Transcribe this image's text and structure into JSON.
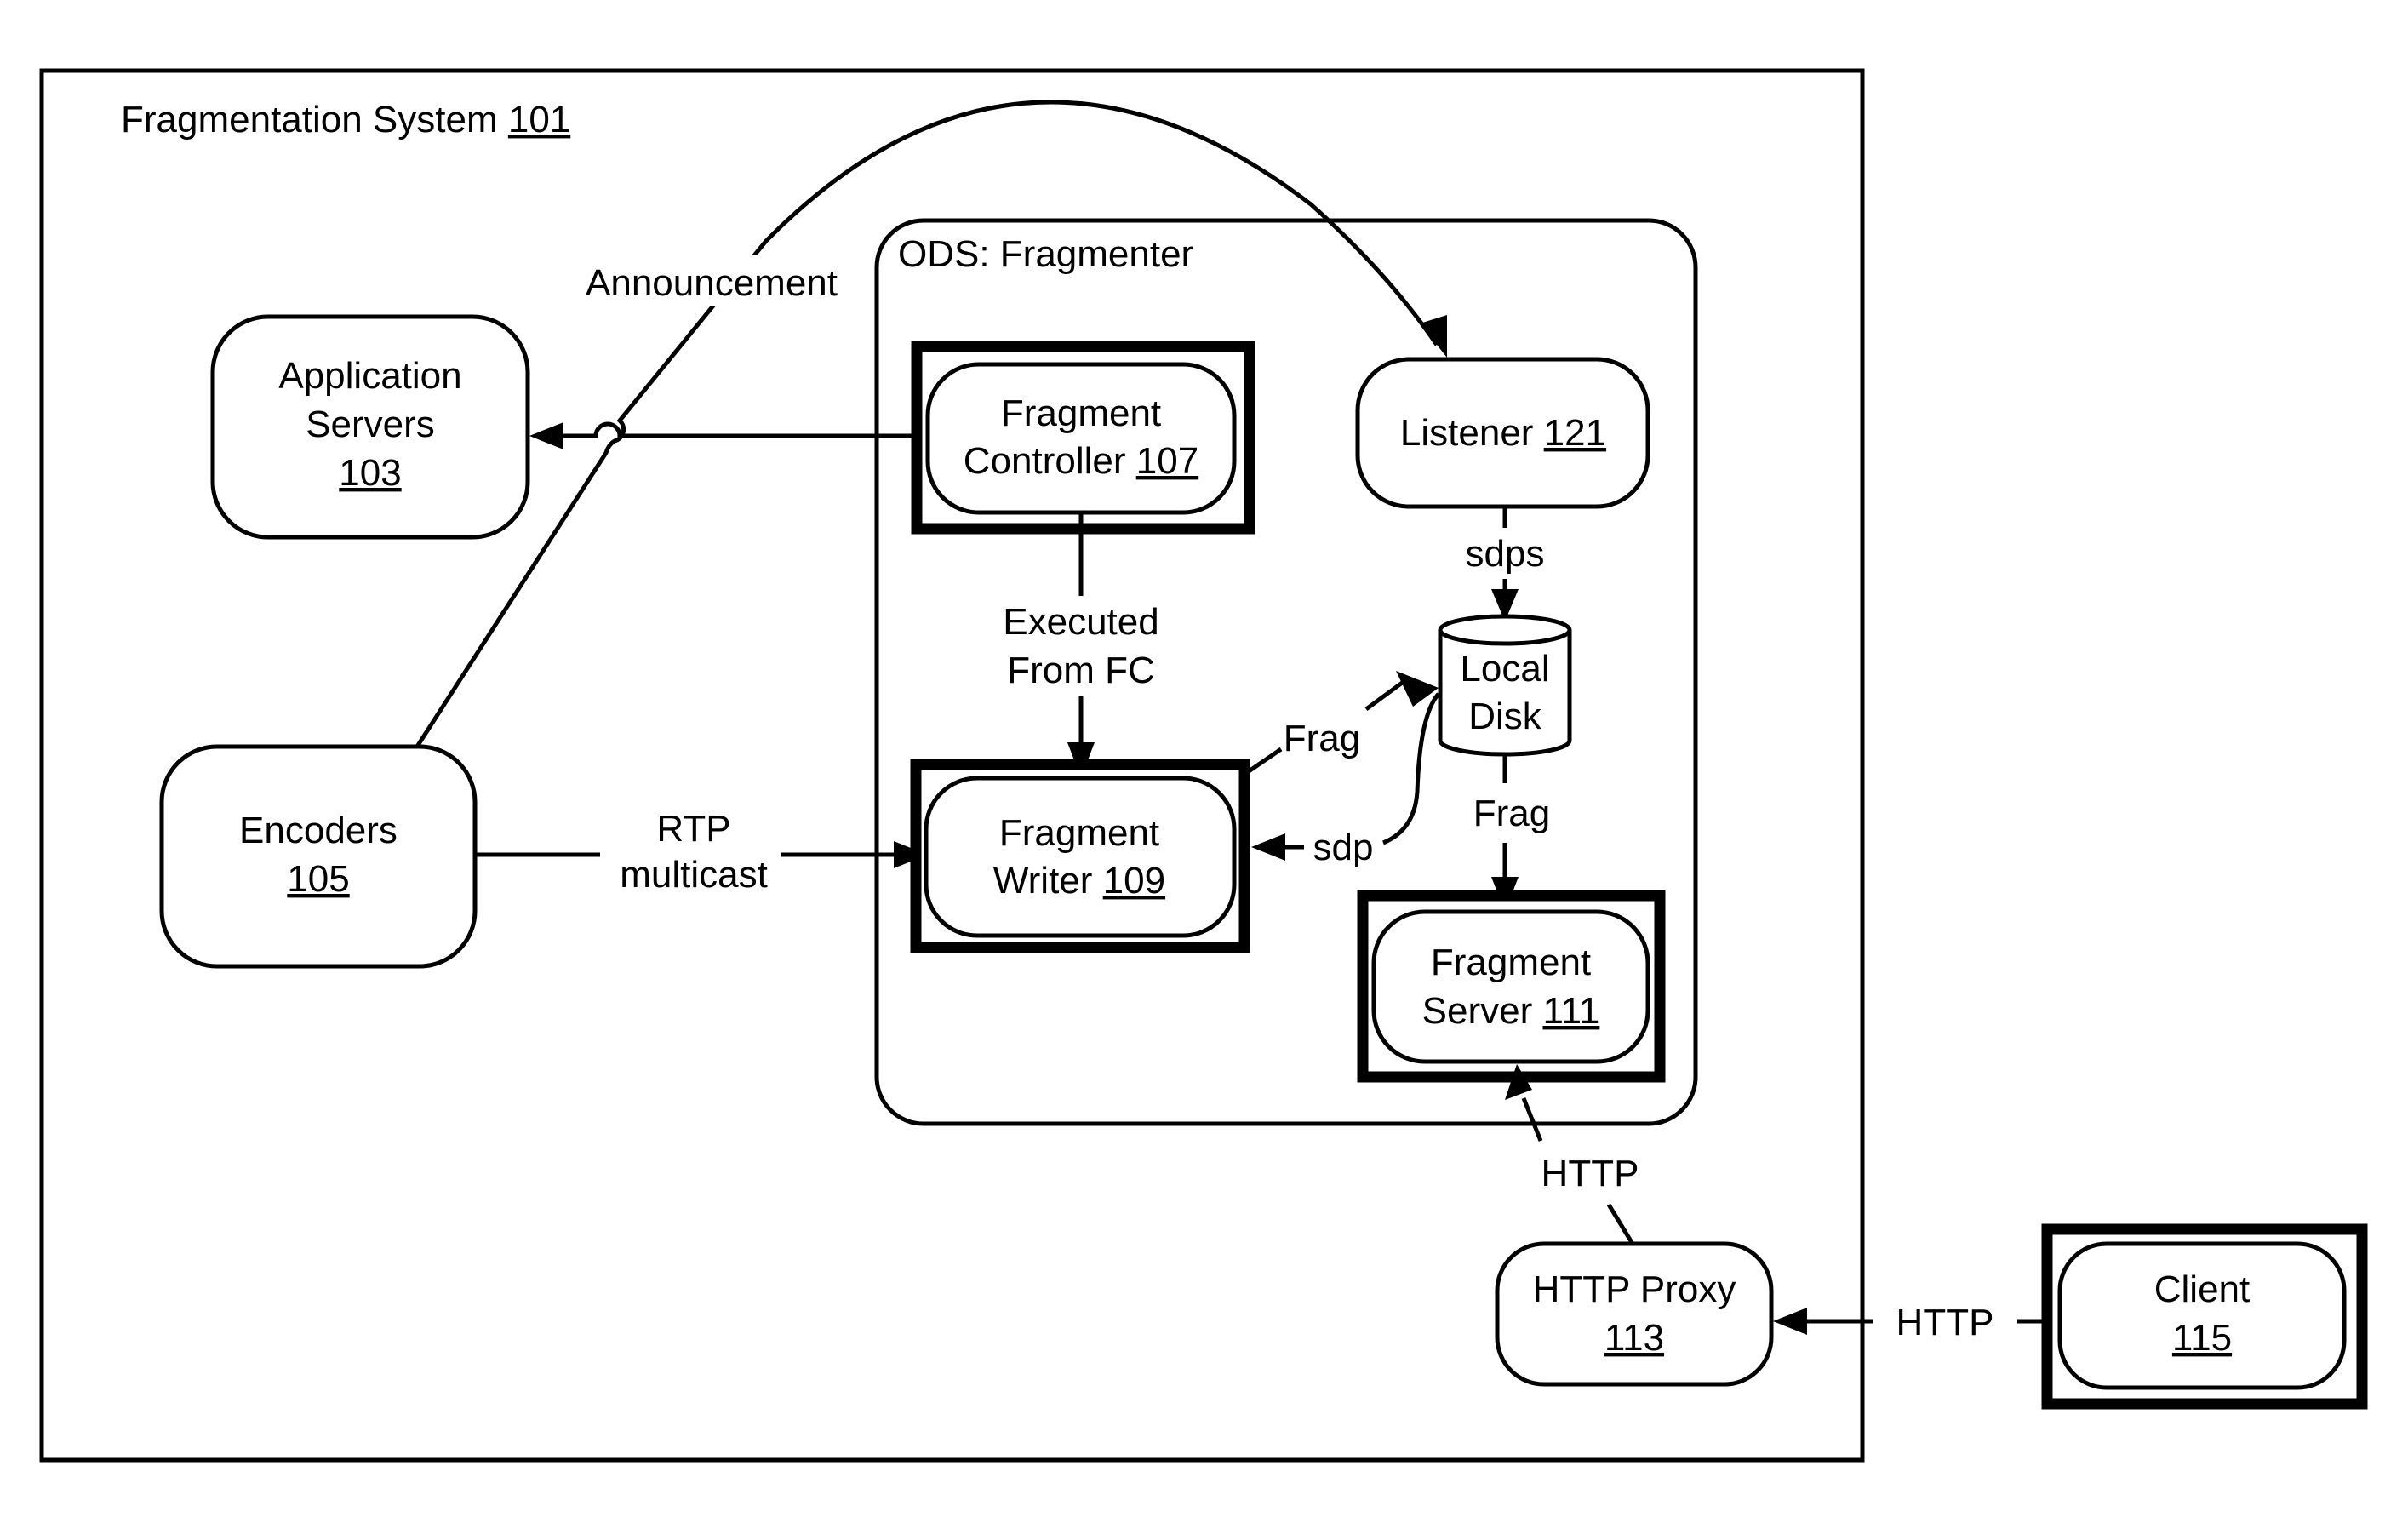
{
  "system": {
    "label": "Fragmentation System ",
    "ref": "101"
  },
  "ods": {
    "label": "ODS: Fragmenter"
  },
  "nodes": {
    "app_servers": {
      "line1": "Application",
      "line2": "Servers",
      "ref": "103"
    },
    "encoders": {
      "line1": "Encoders",
      "ref": "105"
    },
    "fragment_controller": {
      "line1": "Fragment",
      "line2": "Controller ",
      "ref": "107"
    },
    "listener": {
      "line1": "Listener ",
      "ref": "121"
    },
    "local_disk": {
      "line1": "Local",
      "line2": "Disk"
    },
    "fragment_writer": {
      "line1": "Fragment",
      "line2": "Writer ",
      "ref": "109"
    },
    "fragment_server": {
      "line1": "Fragment",
      "line2": "Server ",
      "ref": "111"
    },
    "http_proxy": {
      "line1": "HTTP Proxy",
      "ref": "113"
    },
    "client": {
      "line1": "Client",
      "ref": "115"
    }
  },
  "edges": {
    "announcement": "Announcement",
    "executed_from_fc": {
      "line1": "Executed",
      "line2": "From FC"
    },
    "sdps": "sdps",
    "frag_writer_to_disk": "Frag",
    "sdp": "sdp",
    "frag_disk_to_server": "Frag",
    "rtp": {
      "line1": "RTP",
      "line2": "multicast"
    },
    "http_proxy_to_server": "HTTP",
    "http_client_to_proxy": "HTTP"
  }
}
